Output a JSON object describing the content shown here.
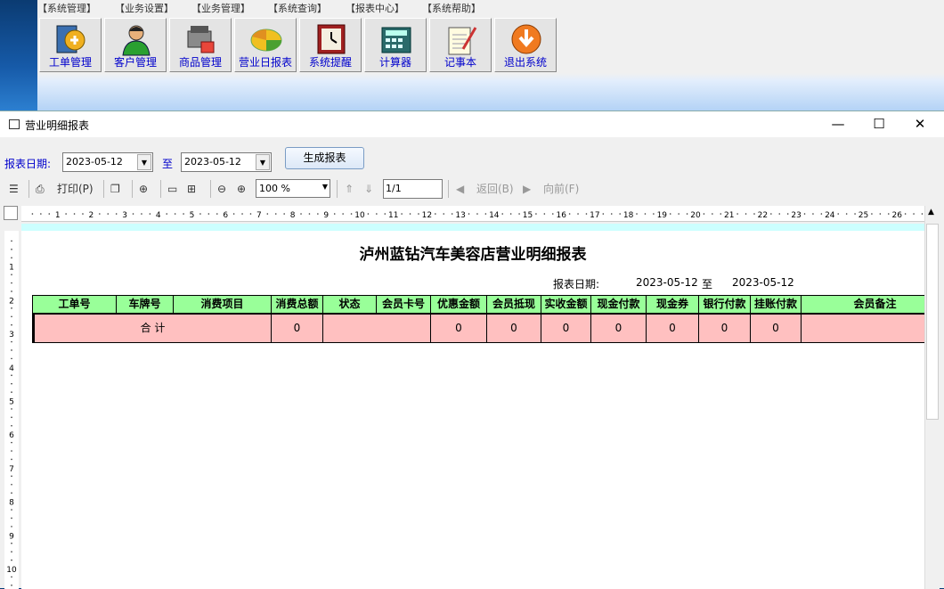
{
  "menu": [
    "【系统管理】",
    "【业务设置】",
    "【业务管理】",
    "【系统查询】",
    "【报表中心】",
    "【系统帮助】"
  ],
  "toolbar": {
    "items": [
      {
        "label": "工单管理",
        "icon": "work-order-icon"
      },
      {
        "label": "客户管理",
        "icon": "customer-icon"
      },
      {
        "label": "商品管理",
        "icon": "product-icon"
      },
      {
        "label": "营业日报表",
        "icon": "daily-report-icon"
      },
      {
        "label": "系统提醒",
        "icon": "reminder-clock-icon"
      },
      {
        "label": "计算器",
        "icon": "calculator-icon"
      },
      {
        "label": "记事本",
        "icon": "notepad-icon"
      },
      {
        "label": "退出系统",
        "icon": "exit-icon"
      }
    ]
  },
  "window": {
    "title": "营业明细报表",
    "minimize": "—",
    "maximize": "☐",
    "close": "✕"
  },
  "filter": {
    "label": "报表日期:",
    "from": "2023-05-12",
    "to_label": "至",
    "to": "2023-05-12",
    "generate": "生成报表"
  },
  "report_toolbar": {
    "print": "打印(P)",
    "zoom": "100 %",
    "page": "1/1",
    "back": "返回(B)",
    "forward": "向前(F)"
  },
  "ruler": {
    "h": [
      "1",
      "2",
      "3",
      "4",
      "5",
      "6",
      "7",
      "8",
      "9",
      "10",
      "11",
      "12",
      "13",
      "14",
      "15",
      "16",
      "17",
      "18",
      "19",
      "20",
      "21",
      "22",
      "23",
      "24",
      "25",
      "26"
    ],
    "v": [
      "1",
      "2",
      "3",
      "4",
      "5",
      "6",
      "7",
      "8",
      "9",
      "10"
    ]
  },
  "report": {
    "title": "泸州蓝钻汽车美容店营业明细报表",
    "date_label": "报表日期:",
    "date_from": "2023-05-12",
    "date_to_label": "至",
    "date_to": "2023-05-12",
    "columns": [
      "工单号",
      "车牌号",
      "消费项目",
      "消费总额",
      "状态",
      "会员卡号",
      "优惠金额",
      "会员抵现",
      "实收金额",
      "现金付款",
      "现金券",
      "银行付款",
      "挂账付款",
      "会员备注"
    ],
    "total_row": {
      "label": "合  计",
      "values": [
        "0",
        "",
        "0",
        "0",
        "0",
        "0",
        "0",
        "0",
        "0",
        ""
      ]
    }
  },
  "colors": {
    "header_bg": "#99ff99",
    "total_bg": "#ffc0c0",
    "band": "#ccffff",
    "link_blue": "#0000cc"
  }
}
